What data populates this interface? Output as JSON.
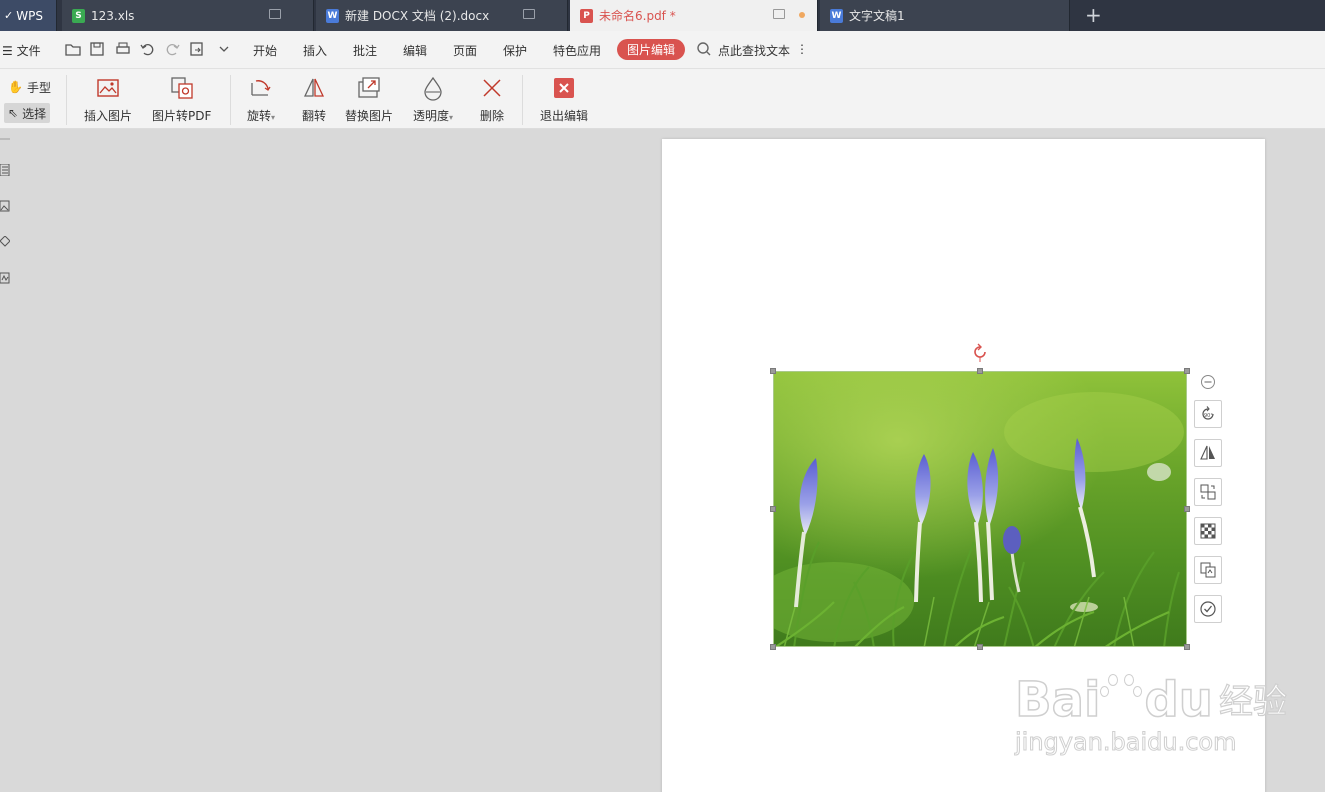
{
  "tabs": {
    "wps_label": "WPS",
    "items": [
      {
        "label": "123.xls",
        "type": "S",
        "color": "#3aaa52"
      },
      {
        "label": "新建 DOCX 文档 (2).docx",
        "type": "W",
        "color": "#4a7bd9"
      },
      {
        "label": "未命名6.pdf *",
        "type": "P",
        "color": "#d9534f"
      },
      {
        "label": "文字文稿1",
        "type": "W",
        "color": "#4a7bd9"
      }
    ]
  },
  "menu": {
    "file_label": "文件",
    "items": [
      "开始",
      "插入",
      "批注",
      "编辑",
      "页面",
      "保护",
      "特色应用"
    ],
    "active": "图片编辑",
    "search_label": "点此查找文本"
  },
  "ribbon": {
    "hand_label": "手型",
    "select_label": "选择",
    "buttons": {
      "insert_image": "插入图片",
      "image_to_pdf": "图片转PDF",
      "rotate": "旋转",
      "flip": "翻转",
      "replace_image": "替换图片",
      "transparency": "透明度",
      "delete": "删除",
      "exit_edit": "退出编辑"
    }
  },
  "watermark": {
    "brand": "Bai",
    "brand2": "du",
    "cn": "经验",
    "url": "jingyan.baidu.com"
  },
  "colors": {
    "accent": "#d9534f",
    "tabbar": "#2f3542"
  }
}
